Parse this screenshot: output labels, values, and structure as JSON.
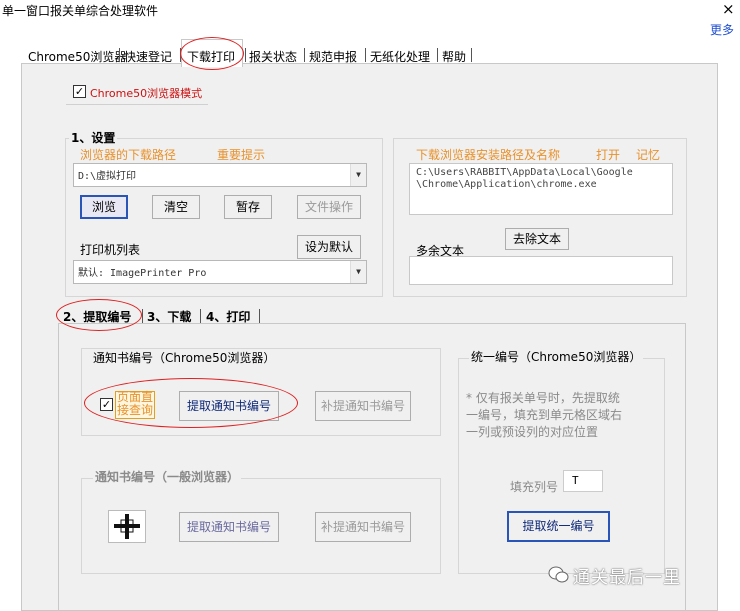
{
  "window": {
    "title": "单一窗口报关单综合处理软件",
    "close": "×",
    "more": "更多"
  },
  "tabs": [
    "Chrome50浏览器",
    "快速登记",
    "下载打印",
    "报关状态",
    "规范申报",
    "无纸化处理",
    "帮助"
  ],
  "chrome_mode": {
    "label": "Chrome50浏览器模式",
    "checked": true
  },
  "settings": {
    "heading": "1、设置",
    "download_path_label": "浏览器的下载路径",
    "important_tip": "重要提示",
    "download_path_value": "D:\\虚拟打印",
    "buttons": {
      "browse": "浏览",
      "clear": "清空",
      "save": "暂存",
      "file_ops": "文件操作"
    },
    "printer_list_label": "打印机列表",
    "set_default": "设为默认",
    "printer_value": "默认: ImagePrinter Pro"
  },
  "browser_install": {
    "label": "下载浏览器安装路径及名称",
    "open": "打开",
    "remember": "记忆",
    "path_line1": "C:\\Users\\RABBIT\\AppData\\Local\\Google",
    "path_line2": "\\Chrome\\Application\\chrome.exe",
    "extra_text_label": "多余文本",
    "remove_text_button": "去除文本"
  },
  "subtabs": [
    "2、提取编号",
    "3、下载",
    "4、打印"
  ],
  "notice_chrome": {
    "heading": "通知书编号（Chrome50浏览器）",
    "checkbox_label_1": "页面直",
    "checkbox_label_2": "接查询",
    "checkbox_checked": true,
    "extract_button": "提取通知书编号",
    "supplement_button": "补提通知书编号"
  },
  "notice_general": {
    "heading": "通知书编号（一般浏览器）",
    "extract_button": "提取通知书编号",
    "supplement_button": "补提通知书编号"
  },
  "unified": {
    "heading": "统一编号（Chrome50浏览器）",
    "note_line1": "* 仅有报关单号时，先提取统",
    "note_line2": "一编号，填充到单元格区域右",
    "note_line3": "一列或预设列的对应位置",
    "fill_column_label": "填充列号",
    "fill_column_value": "T",
    "extract_button": "提取统一编号"
  },
  "watermark": "通关最后一里"
}
